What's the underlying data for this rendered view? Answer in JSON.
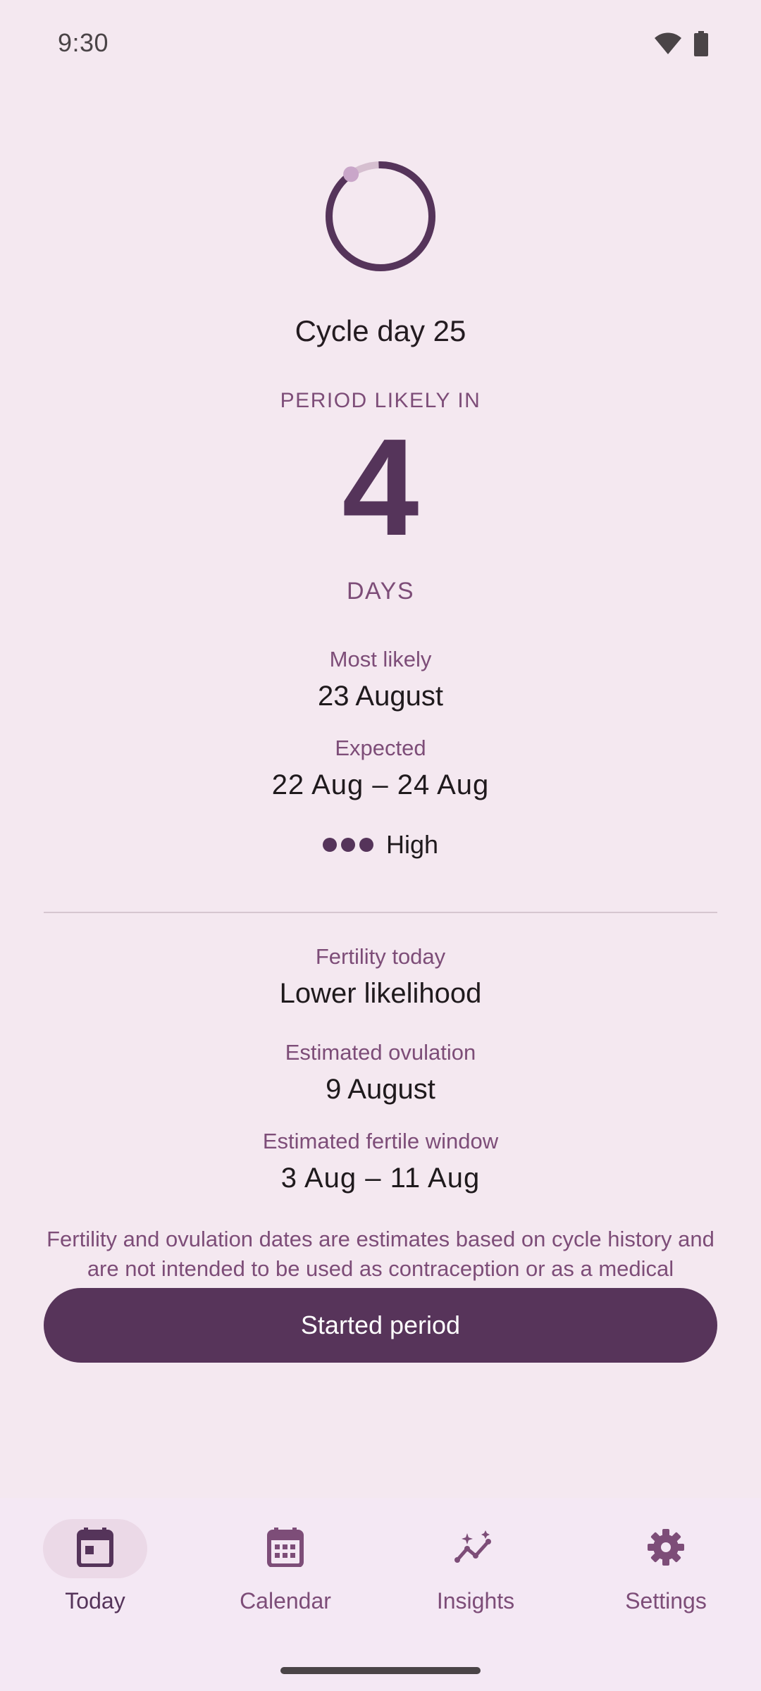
{
  "status_bar": {
    "time": "9:30",
    "icons": [
      "wifi-icon",
      "battery-icon"
    ]
  },
  "cycle": {
    "day_label": "Cycle day 25",
    "progress_fraction": 0.96
  },
  "period": {
    "heading": "PERIOD LIKELY IN",
    "days_number": "4",
    "days_unit": "DAYS",
    "most_likely_label": "Most likely",
    "most_likely_value": "23 August",
    "expected_label": "Expected",
    "expected_value": "22 Aug – 24 Aug",
    "confidence_label": "High",
    "confidence_level": 3
  },
  "fertility": {
    "today_label": "Fertility today",
    "today_value": "Lower likelihood",
    "ovulation_label": "Estimated ovulation",
    "ovulation_value": "9 August",
    "window_label": "Estimated fertile window",
    "window_value": "3 Aug – 11 Aug",
    "disclaimer": "Fertility and ovulation dates are estimates based on cycle history and are not intended to be used as contraception or as a medical diagnosis."
  },
  "actions": {
    "started_period_label": "Started period"
  },
  "nav": {
    "items": [
      {
        "label": "Today",
        "icon": "calendar-today-icon",
        "active": true
      },
      {
        "label": "Calendar",
        "icon": "calendar-month-icon",
        "active": false
      },
      {
        "label": "Insights",
        "icon": "insights-icon",
        "active": false
      },
      {
        "label": "Settings",
        "icon": "gear-icon",
        "active": false
      }
    ]
  },
  "colors": {
    "background": "#f4e8f0",
    "accent": "#57345a",
    "label": "#7d4d78",
    "ring_track": "#d6bfd0",
    "ring_dot": "#c9a6c9"
  }
}
